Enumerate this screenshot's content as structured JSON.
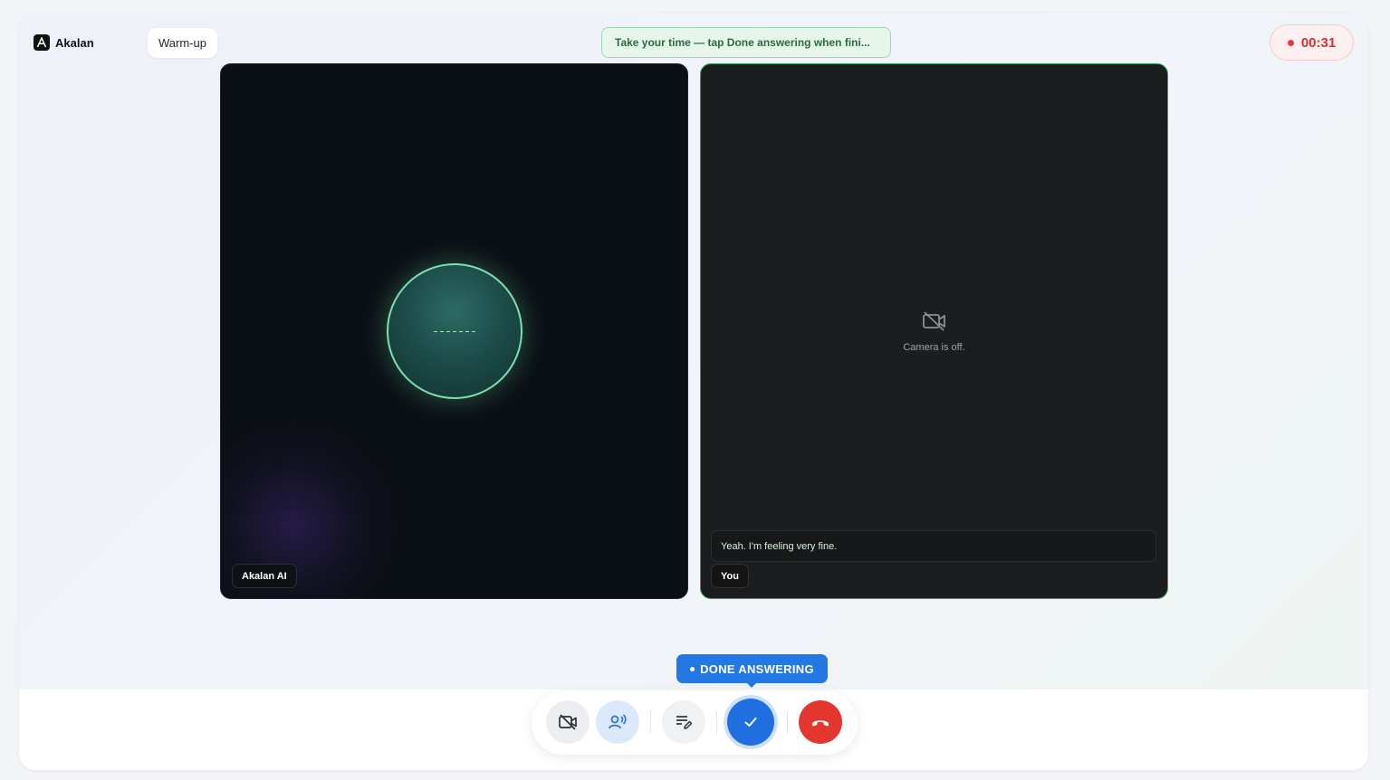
{
  "app": {
    "name": "Akalan"
  },
  "header": {
    "phase": "Warm-up",
    "hint": "Take your time — tap Done answering when fini...",
    "timer": "00:31"
  },
  "ai_tile": {
    "label": "Akalan AI"
  },
  "user_tile": {
    "label": "You",
    "camera_status": "Camera is off.",
    "caption": "Yeah. I'm feeling very fine."
  },
  "controls": {
    "tooltip": "DONE ANSWERING",
    "buttons": [
      {
        "name": "camera-toggle",
        "icon": "video-off-icon"
      },
      {
        "name": "voice",
        "icon": "voice-icon"
      },
      {
        "name": "notes",
        "icon": "notes-edit-icon"
      },
      {
        "name": "done-answering",
        "icon": "check-icon"
      },
      {
        "name": "end-call",
        "icon": "phone-hangup-icon"
      }
    ]
  },
  "colors": {
    "accent": "#1f6fe0",
    "danger": "#e2362f",
    "success_border": "#3a9b57",
    "timer_red": "#d3302f"
  }
}
